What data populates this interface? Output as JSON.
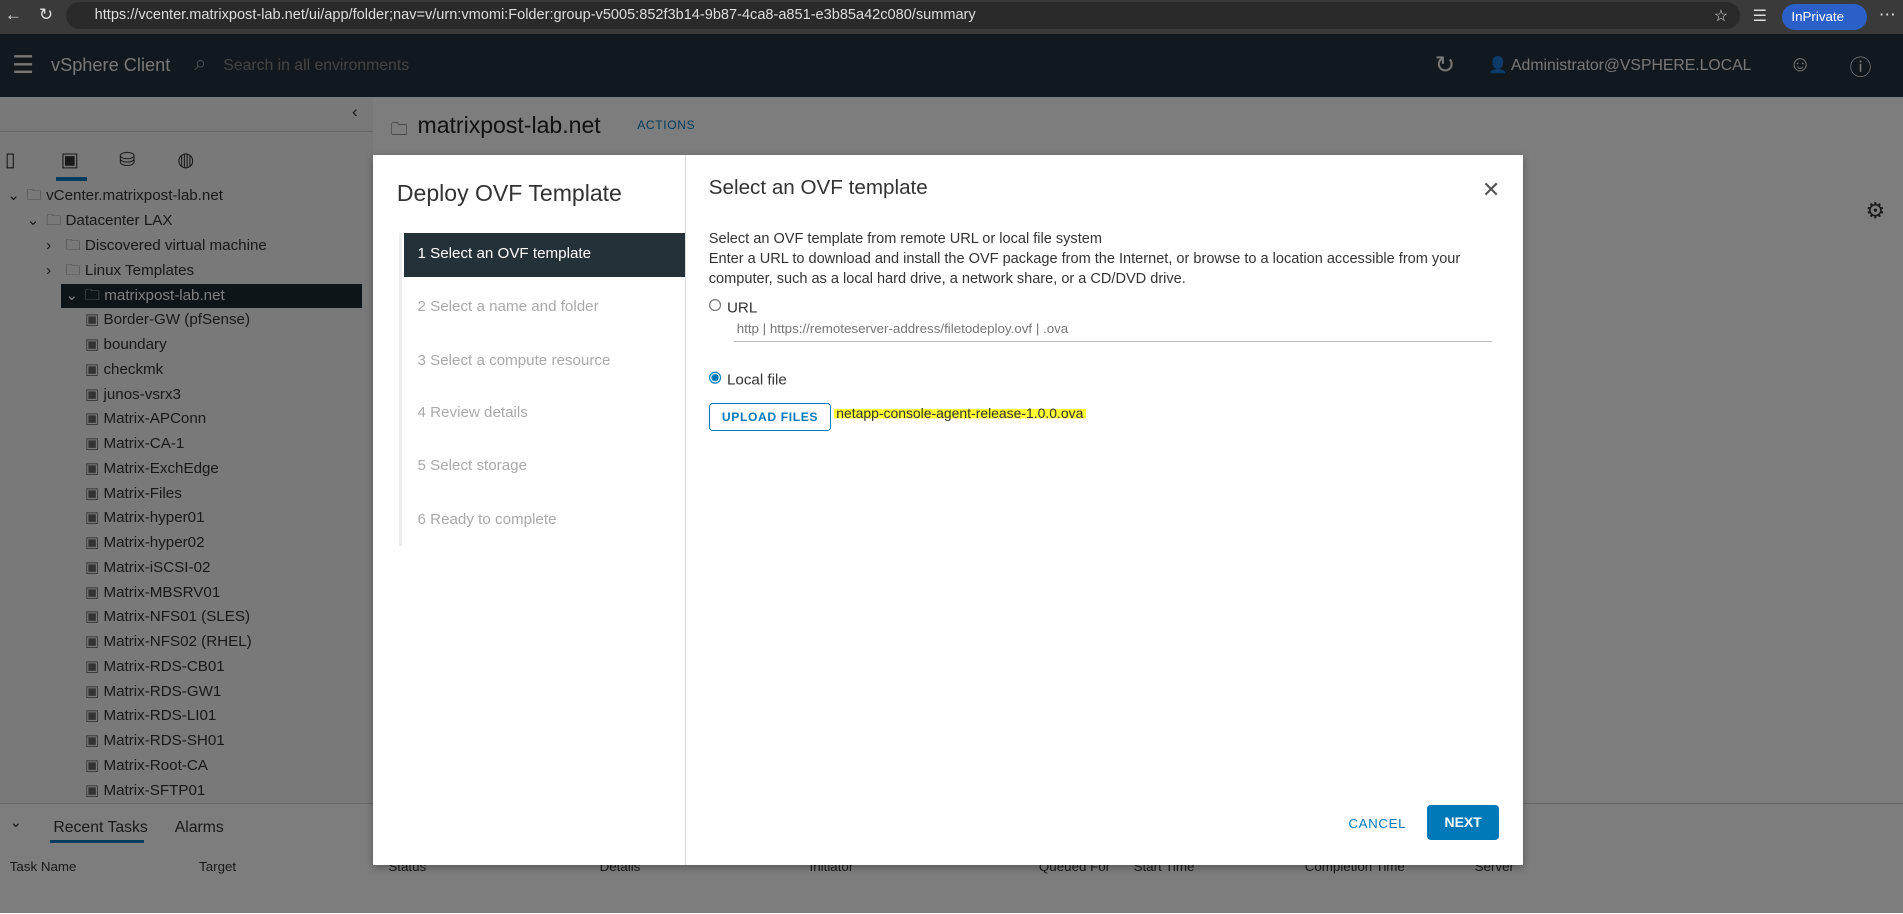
{
  "browser": {
    "url": "https://vcenter.matrixpost-lab.net/ui/app/folder;nav=v/urn:vmomi:Folder:group-v5005:852f3b14-9b87-4ca8-a851-e3b85a42c080/summary",
    "inprivate": "InPrivate"
  },
  "header": {
    "app": "vSphere Client",
    "search_placeholder": "Search in all environments",
    "user": "Administrator@VSPHERE.LOCAL"
  },
  "page": {
    "title": "matrixpost-lab.net",
    "actions": "ACTIONS"
  },
  "tree": [
    {
      "label": "vCenter.matrixpost-lab.net",
      "level": 0
    },
    {
      "label": "Datacenter LAX",
      "level": 1
    },
    {
      "label": "Discovered virtual machine",
      "level": 2
    },
    {
      "label": "Linux Templates",
      "level": 2
    },
    {
      "label": "matrixpost-lab.net",
      "level": 2,
      "selected": true
    },
    {
      "label": "Border-GW (pfSense)",
      "level": 3
    },
    {
      "label": "boundary",
      "level": 3
    },
    {
      "label": "checkmk",
      "level": 3
    },
    {
      "label": "junos-vsrx3",
      "level": 3
    },
    {
      "label": "Matrix-APConn",
      "level": 3
    },
    {
      "label": "Matrix-CA-1",
      "level": 3
    },
    {
      "label": "Matrix-ExchEdge",
      "level": 3
    },
    {
      "label": "Matrix-Files",
      "level": 3
    },
    {
      "label": "Matrix-hyper01",
      "level": 3
    },
    {
      "label": "Matrix-hyper02",
      "level": 3
    },
    {
      "label": "Matrix-iSCSI-02",
      "level": 3
    },
    {
      "label": "Matrix-MBSRV01",
      "level": 3
    },
    {
      "label": "Matrix-NFS01 (SLES)",
      "level": 3
    },
    {
      "label": "Matrix-NFS02 (RHEL)",
      "level": 3
    },
    {
      "label": "Matrix-RDS-CB01",
      "level": 3
    },
    {
      "label": "Matrix-RDS-GW1",
      "level": 3
    },
    {
      "label": "Matrix-RDS-LI01",
      "level": 3
    },
    {
      "label": "Matrix-RDS-SH01",
      "level": 3
    },
    {
      "label": "Matrix-Root-CA",
      "level": 3
    },
    {
      "label": "Matrix-SFTP01",
      "level": 3
    }
  ],
  "bottom": {
    "tabs": [
      "Recent Tasks",
      "Alarms"
    ],
    "columns": [
      "Task Name",
      "Target",
      "Status",
      "Details",
      "Initiator",
      "Queued For",
      "Start Time",
      "Completion Time",
      "Server"
    ]
  },
  "modal": {
    "wizard_title": "Deploy OVF Template",
    "steps": [
      "1  Select an OVF template",
      "2  Select a name and folder",
      "3  Select a compute resource",
      "4  Review details",
      "5  Select storage",
      "6  Ready to complete"
    ],
    "title": "Select an OVF template",
    "desc1": "Select an OVF template from remote URL or local file system",
    "desc2": "Enter a URL to download and install the OVF package from the Internet, or browse to a location accessible from your computer, such as a local hard drive, a network share, or a CD/DVD drive.",
    "url_label": "URL",
    "url_placeholder": "http | https://remoteserver-address/filetodeploy.ovf | .ova",
    "local_label": "Local file",
    "upload": "UPLOAD FILES",
    "file": "netapp-console-agent-release-1.0.0.ova",
    "cancel": "CANCEL",
    "next": "NEXT"
  },
  "colors": {
    "accent": "#0079b8",
    "header": "#25323c",
    "highlight": "#ffff33"
  }
}
